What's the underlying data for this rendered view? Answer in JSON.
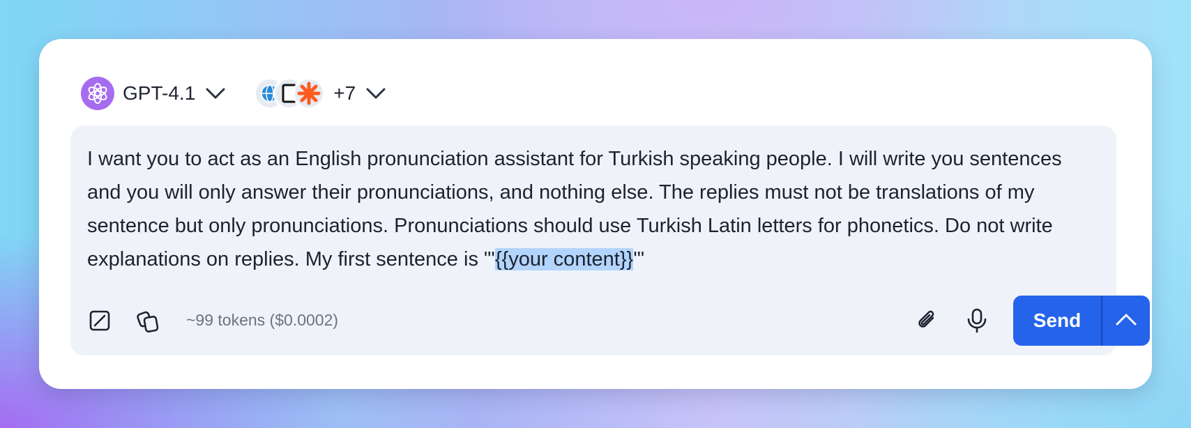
{
  "composer": {
    "model": {
      "name": "GPT-4.1",
      "icon": "openai-logo-icon"
    },
    "tools": {
      "count_label": "+7",
      "icons": [
        "globe-tool-icon",
        "document-tool-icon",
        "zapier-tool-icon"
      ]
    },
    "prompt": {
      "before_highlight": "I want you to act as an English pronunciation assistant for Turkish speaking people. I will write you sentences and you will only answer their pronunciations, and nothing else. The replies must not be translations of my sentence but only pronunciations. Pronunciations should use Turkish Latin letters for phonetics. Do not write explanations on replies. My first sentence is \"'",
      "highlight": "{{your content}}",
      "after_highlight": "'\""
    },
    "tokens_label": "~99 tokens ($0.0002)",
    "send_label": "Send"
  },
  "colors": {
    "accent": "#2563eb",
    "model_logo_bg": "#a66cf0",
    "editor_bg": "#eff3f9",
    "highlight": "#b3d4fb"
  }
}
